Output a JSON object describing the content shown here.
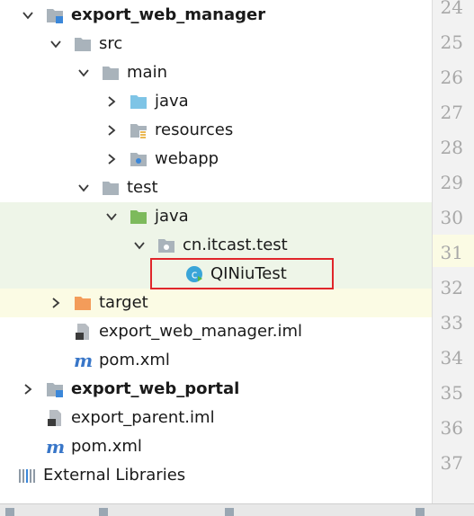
{
  "tree": {
    "rows": [
      {
        "label": "export_web_manager",
        "icon": "module-folder-icon",
        "expanded": true,
        "bold": true
      },
      {
        "label": "src",
        "icon": "folder-icon",
        "expanded": true
      },
      {
        "label": "main",
        "icon": "folder-icon",
        "expanded": true
      },
      {
        "label": "java",
        "icon": "source-folder-icon",
        "expanded": false
      },
      {
        "label": "resources",
        "icon": "resources-folder-icon",
        "expanded": false
      },
      {
        "label": "webapp",
        "icon": "web-folder-icon",
        "expanded": false
      },
      {
        "label": "test",
        "icon": "folder-icon",
        "expanded": true
      },
      {
        "label": "java",
        "icon": "test-source-folder-icon",
        "expanded": true
      },
      {
        "label": "cn.itcast.test",
        "icon": "package-icon",
        "expanded": true
      },
      {
        "label": "QINiuTest",
        "icon": "java-class-icon",
        "selected": true
      },
      {
        "label": "target",
        "icon": "excluded-folder-icon",
        "expanded": false
      },
      {
        "label": "export_web_manager.iml",
        "icon": "iml-file-icon"
      },
      {
        "label": "pom.xml",
        "icon": "maven-icon"
      },
      {
        "label": "export_web_portal",
        "icon": "module-folder-icon",
        "expanded": false,
        "bold": true
      },
      {
        "label": "export_parent.iml",
        "icon": "iml-file-icon"
      },
      {
        "label": "pom.xml",
        "icon": "maven-icon"
      },
      {
        "label": "External Libraries",
        "icon": "libraries-icon"
      }
    ]
  },
  "gutter": {
    "line_numbers": [
      "24",
      "25",
      "26",
      "27",
      "28",
      "29",
      "30",
      "31",
      "32",
      "33",
      "34",
      "35",
      "36",
      "37"
    ],
    "current_line": "31"
  },
  "colors": {
    "folder": "#a9b3bb",
    "source": "#7ec4e6",
    "test": "#7dba5c",
    "excluded": "#f39c5a",
    "maven": "#3876c8",
    "class": "#3aa5d8",
    "highlight_box": "#e0262b",
    "gutter_bg": "#f2f2f2"
  }
}
